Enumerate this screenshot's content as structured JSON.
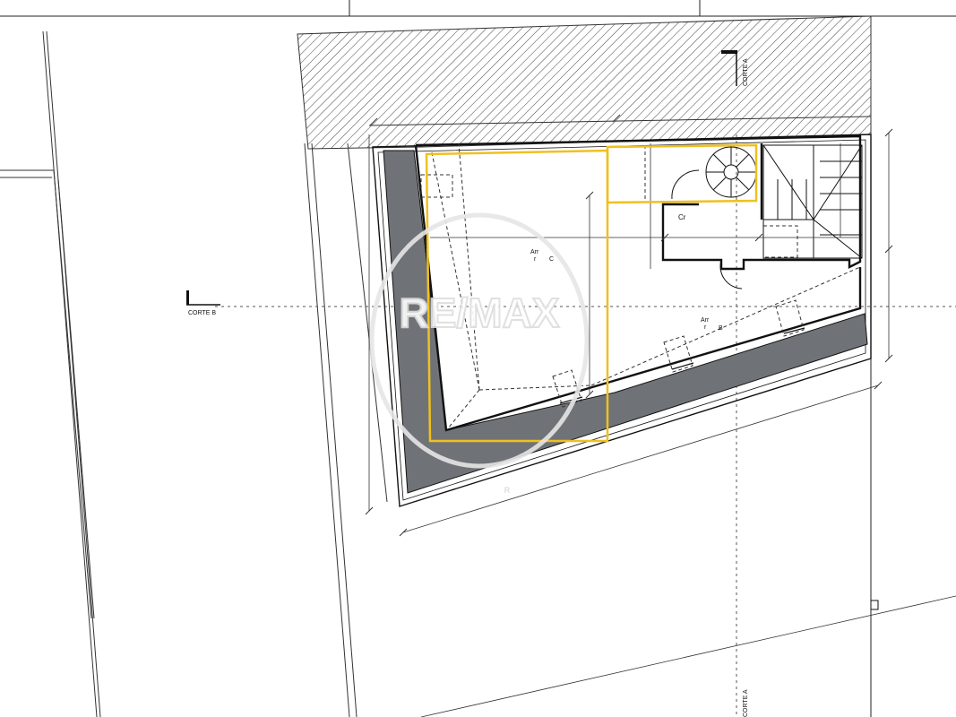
{
  "sections": {
    "corte_a": "CORTE A",
    "corte_b": "CORTE B"
  },
  "rooms": {
    "arr_c_line1": "Arr",
    "arr_c_line2": "r",
    "arr_c_letter": "C",
    "arr_b_line1": "Arr",
    "arr_b_line2": "r",
    "arr_b_letter": "B",
    "cr": "Cr"
  },
  "watermark": {
    "brand": "RE/MAX",
    "mark": "R"
  },
  "colors": {
    "line": "#111111",
    "thin_line": "#555555",
    "highlight": "#f0c020",
    "roof_fill": "#6f7377",
    "hatch": "#444444",
    "watermark": "#e6e6e6"
  }
}
